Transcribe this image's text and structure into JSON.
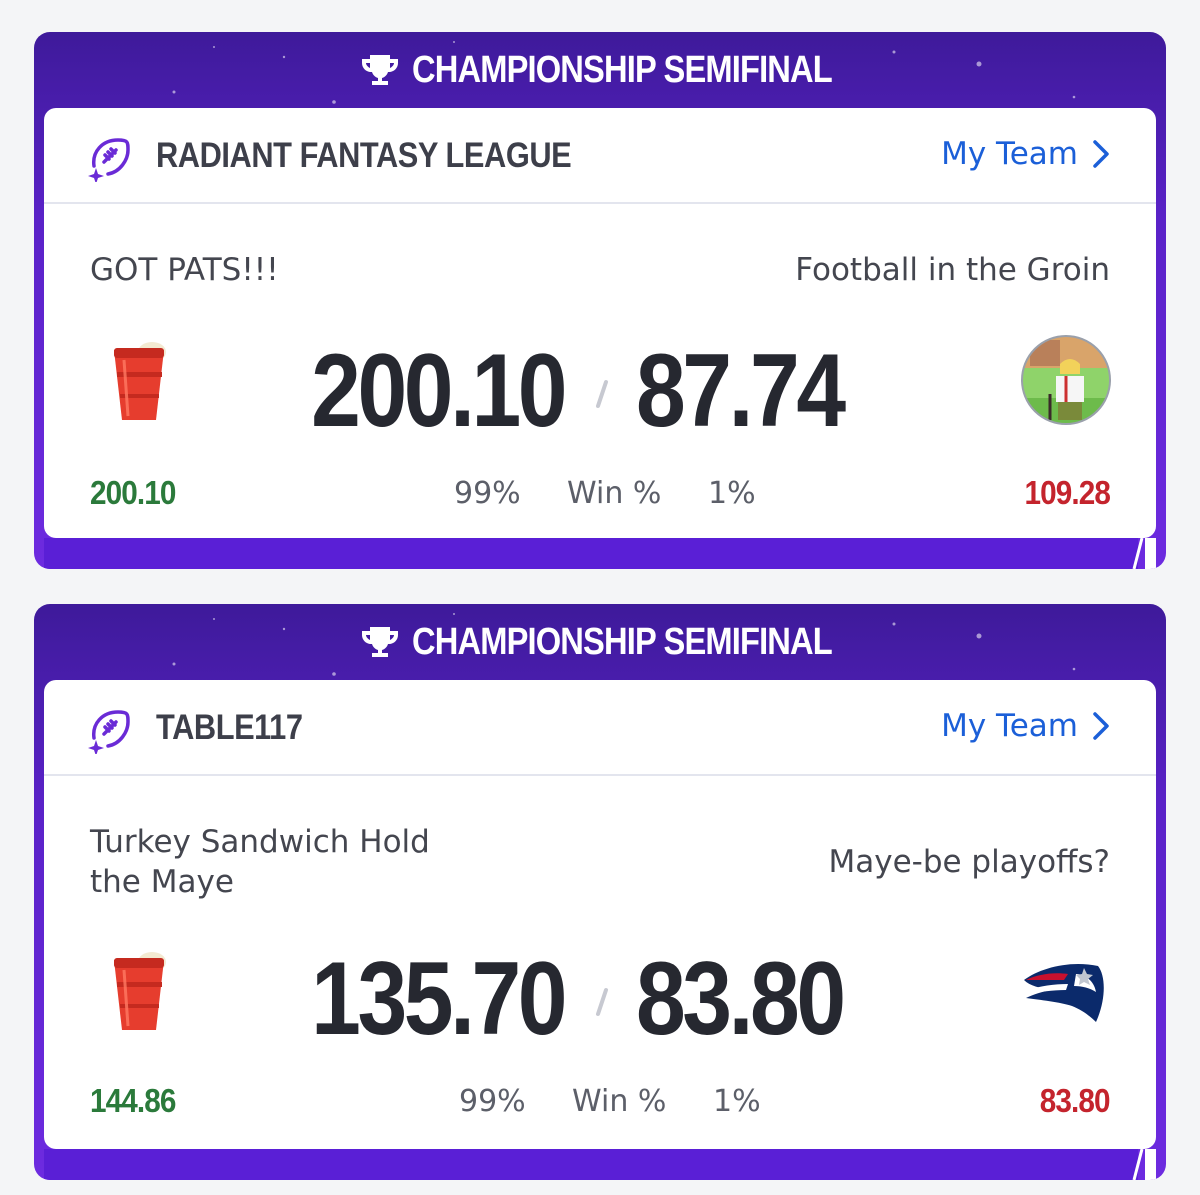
{
  "matchups": [
    {
      "banner_title": "CHAMPIONSHIP SEMIFINAL",
      "league_name": "RADIANT FANTASY LEAGUE",
      "my_team_link": "My Team",
      "left_team": {
        "name": "GOT PATS!!!",
        "score": "200.10",
        "projected": "200.10",
        "win_pct": "99%",
        "avatar": "red-cup-beer-icon"
      },
      "win_label": "Win %",
      "right_team": {
        "name": "Football in the Groin",
        "score": "87.74",
        "projected": "109.28",
        "win_pct": "1%",
        "avatar": "cartoon-old-man-avatar"
      }
    },
    {
      "banner_title": "CHAMPIONSHIP SEMIFINAL",
      "league_name": "TABLE117",
      "my_team_link": "My Team",
      "left_team": {
        "name": "Turkey Sandwich Hold the Maye",
        "score": "135.70",
        "projected": "144.86",
        "win_pct": "99%",
        "avatar": "red-cup-beer-icon"
      },
      "win_label": "Win %",
      "right_team": {
        "name": "Maye-be playoffs?",
        "score": "83.80",
        "projected": "83.80",
        "win_pct": "1%",
        "avatar": "patriots-logo-icon"
      }
    }
  ],
  "colors": {
    "banner_purple": "#5a22c8",
    "link_blue": "#1b5fd8",
    "projected_green": "#2b7a3b",
    "projected_red": "#c4242d",
    "score_dark": "#262830"
  }
}
